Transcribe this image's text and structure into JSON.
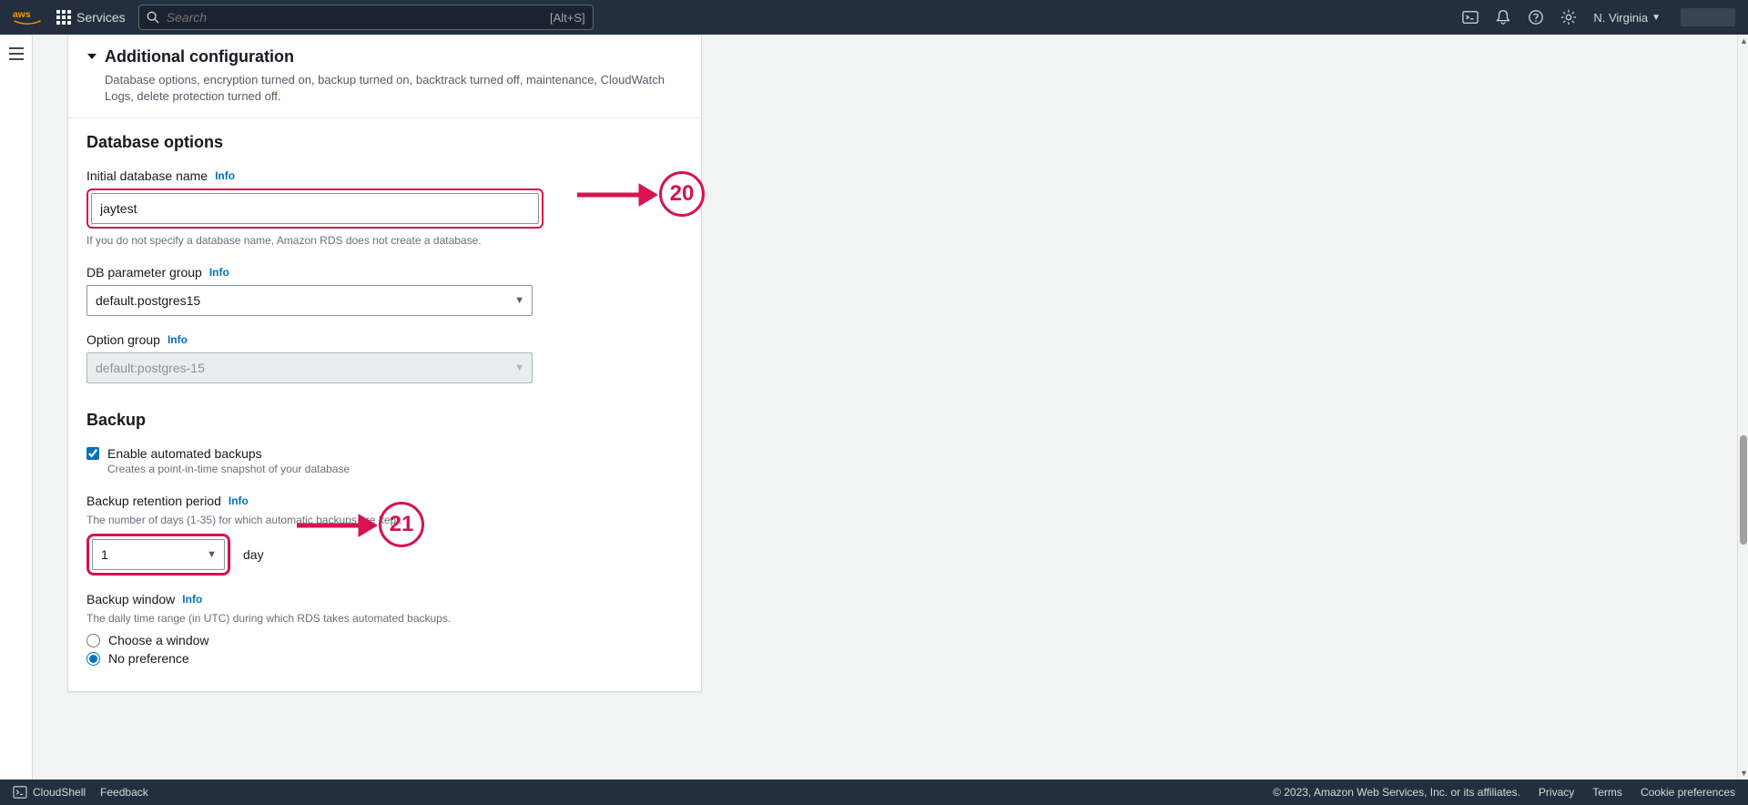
{
  "header": {
    "services_label": "Services",
    "search_placeholder": "Search",
    "search_hotkey": "[Alt+S]",
    "region": "N. Virginia"
  },
  "expander": {
    "title": "Additional configuration",
    "desc": "Database options, encryption turned on, backup turned on, backtrack turned off, maintenance, CloudWatch Logs, delete protection turned off."
  },
  "db_options": {
    "title": "Database options",
    "initial_db_label": "Initial database name",
    "initial_db_value": "jaytest",
    "initial_db_help": "If you do not specify a database name, Amazon RDS does not create a database.",
    "param_group_label": "DB parameter group",
    "param_group_value": "default.postgres15",
    "option_group_label": "Option group",
    "option_group_value": "default:postgres-15"
  },
  "backup": {
    "title": "Backup",
    "enable_label": "Enable automated backups",
    "enable_desc": "Creates a point-in-time snapshot of your database",
    "retention_label": "Backup retention period",
    "retention_help": "The number of days (1-35) for which automatic backups are kept.",
    "retention_value": "1",
    "retention_unit": "day",
    "window_label": "Backup window",
    "window_help": "The daily time range (in UTC) during which RDS takes automated backups.",
    "radio_choose": "Choose a window",
    "radio_nopref": "No preference"
  },
  "info_label": "Info",
  "anno": {
    "b20": "20",
    "b21": "21"
  },
  "footer": {
    "cloudshell": "CloudShell",
    "feedback": "Feedback",
    "copyright": "© 2023, Amazon Web Services, Inc. or its affiliates.",
    "privacy": "Privacy",
    "terms": "Terms",
    "cookie": "Cookie preferences"
  }
}
